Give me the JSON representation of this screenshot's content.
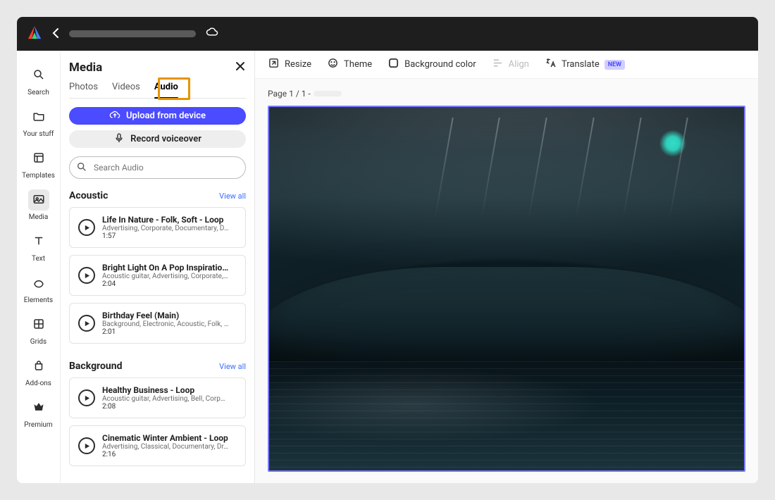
{
  "rail": {
    "items": [
      {
        "key": "search",
        "label": "Search"
      },
      {
        "key": "yourstuff",
        "label": "Your stuff"
      },
      {
        "key": "templates",
        "label": "Templates"
      },
      {
        "key": "media",
        "label": "Media"
      },
      {
        "key": "text",
        "label": "Text"
      },
      {
        "key": "elements",
        "label": "Elements"
      },
      {
        "key": "grids",
        "label": "Grids"
      },
      {
        "key": "addons",
        "label": "Add-ons"
      },
      {
        "key": "premium",
        "label": "Premium"
      }
    ]
  },
  "panel": {
    "title": "Media",
    "tabs": {
      "photos": "Photos",
      "videos": "Videos",
      "audio": "Audio"
    },
    "upload_label": "Upload from device",
    "record_label": "Record voiceover",
    "search": {
      "placeholder": "Search Audio"
    },
    "sections": [
      {
        "title": "Acoustic",
        "view_all": "View all",
        "tracks": [
          {
            "title": "Life In Nature - Folk, Soft - Loop",
            "tags": "Advertising, Corporate, Documentary, D…",
            "duration": "1:57"
          },
          {
            "title": "Bright Light On A Pop Inspiratio…",
            "tags": "Acoustic guitar, Advertising, Corporate, …",
            "duration": "2:04"
          },
          {
            "title": "Birthday Feel (Main)",
            "tags": "Background, Electronic, Acoustic, Folk, …",
            "duration": "2:01"
          }
        ]
      },
      {
        "title": "Background",
        "view_all": "View all",
        "tracks": [
          {
            "title": "Healthy Business - Loop",
            "tags": "Acoustic guitar, Advertising, Bell, Corpor…",
            "duration": "2:08"
          },
          {
            "title": "Cinematic Winter Ambient - Loop",
            "tags": "Advertising, Classical, Documentary, Dr…",
            "duration": "2:16"
          }
        ]
      }
    ]
  },
  "toolbar": {
    "resize": "Resize",
    "theme": "Theme",
    "background": "Background color",
    "align": "Align",
    "translate": "Translate",
    "new_badge": "NEW"
  },
  "canvas": {
    "page_label": "Page 1 / 1 -"
  }
}
